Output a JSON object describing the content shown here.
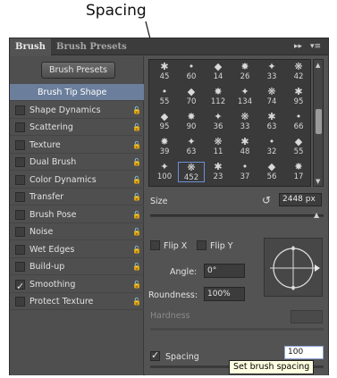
{
  "callout": {
    "label": "Spacing"
  },
  "panel": {
    "tabs": [
      {
        "label": "Brush",
        "active": true
      },
      {
        "label": "Brush Presets",
        "active": false
      }
    ],
    "presets_button": "Brush Presets",
    "options": [
      {
        "label": "Brush Tip Shape",
        "selected": true,
        "checkbox": false,
        "checked": false,
        "lock": false
      },
      {
        "label": "Shape Dynamics",
        "selected": false,
        "checkbox": true,
        "checked": false,
        "lock": true
      },
      {
        "label": "Scattering",
        "selected": false,
        "checkbox": true,
        "checked": false,
        "lock": true
      },
      {
        "label": "Texture",
        "selected": false,
        "checkbox": true,
        "checked": false,
        "lock": true
      },
      {
        "label": "Dual Brush",
        "selected": false,
        "checkbox": true,
        "checked": false,
        "lock": true
      },
      {
        "label": "Color Dynamics",
        "selected": false,
        "checkbox": true,
        "checked": false,
        "lock": true
      },
      {
        "label": "Transfer",
        "selected": false,
        "checkbox": true,
        "checked": false,
        "lock": true
      },
      {
        "label": "Brush Pose",
        "selected": false,
        "checkbox": true,
        "checked": false,
        "lock": true
      },
      {
        "label": "Noise",
        "selected": false,
        "checkbox": true,
        "checked": false,
        "lock": true
      },
      {
        "label": "Wet Edges",
        "selected": false,
        "checkbox": true,
        "checked": false,
        "lock": true
      },
      {
        "label": "Build-up",
        "selected": false,
        "checkbox": true,
        "checked": false,
        "lock": true
      },
      {
        "label": "Smoothing",
        "selected": false,
        "checkbox": true,
        "checked": true,
        "lock": true
      },
      {
        "label": "Protect Texture",
        "selected": false,
        "checkbox": true,
        "checked": false,
        "lock": true
      }
    ],
    "brush_tips": [
      [
        "45",
        "60",
        "14",
        "26",
        "33",
        "42"
      ],
      [
        "55",
        "70",
        "112",
        "134",
        "74",
        "95"
      ],
      [
        "95",
        "90",
        "36",
        "33",
        "63",
        "66"
      ],
      [
        "39",
        "63",
        "11",
        "48",
        "32",
        "55"
      ],
      [
        "100",
        "452",
        "23",
        "37",
        "56",
        "17"
      ]
    ],
    "selected_tip": "452",
    "size_label": "Size",
    "size_value": "2448 px",
    "flip_x": "Flip X",
    "flip_y": "Flip Y",
    "angle_label": "Angle:",
    "angle_value": "0°",
    "roundness_label": "Roundness:",
    "roundness_value": "100%",
    "hardness_label": "Hardness",
    "spacing_label": "Spacing",
    "spacing_checked": true,
    "spacing_value": "100",
    "tooltip": "Set brush spacing"
  }
}
